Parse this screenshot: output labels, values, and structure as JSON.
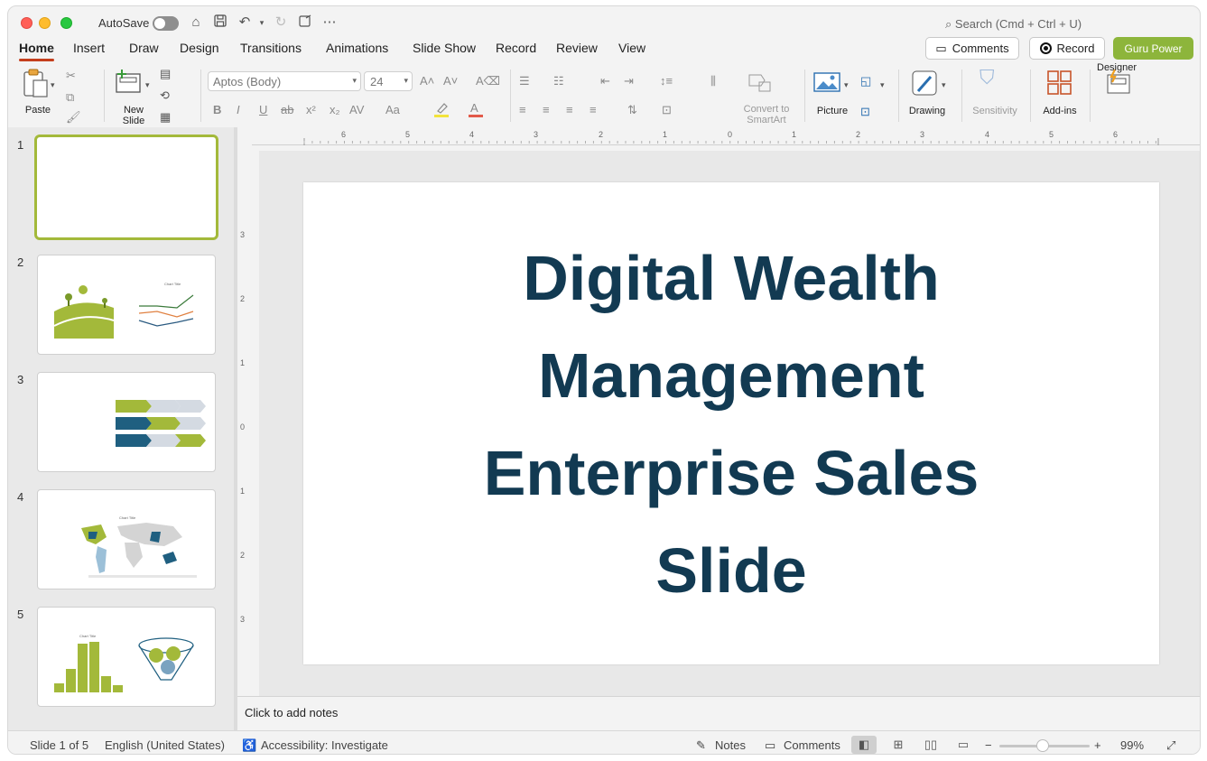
{
  "titlebar": {
    "autosave_label": "AutoSave",
    "search_placeholder": "Search (Cmd + Ctrl + U)"
  },
  "tabs": [
    "Home",
    "Insert",
    "Draw",
    "Design",
    "Transitions",
    "Animations",
    "Slide Show",
    "Record",
    "Review",
    "View"
  ],
  "active_tab": "Home",
  "header_buttons": {
    "comments": "Comments",
    "record": "Record",
    "guru": "Guru Power"
  },
  "ribbon": {
    "paste": "Paste",
    "new_slide_line1": "New",
    "new_slide_line2": "Slide",
    "font_name": "Aptos (Body)",
    "font_size": "24",
    "convert_line1": "Convert to",
    "convert_line2": "SmartArt",
    "picture": "Picture",
    "drawing": "Drawing",
    "sensitivity": "Sensitivity",
    "addins": "Add-ins",
    "designer": "Designer"
  },
  "slides": [
    {
      "num": "1",
      "selected": true
    },
    {
      "num": "2",
      "thumb_chart_title": "Chart Title"
    },
    {
      "num": "3"
    },
    {
      "num": "4",
      "thumb_chart_title": "Chart Title"
    },
    {
      "num": "5",
      "thumb_chart_title": "Chart Title"
    }
  ],
  "slide": {
    "title_line1": "Digital Wealth",
    "title_line2": "Management",
    "title_line3": "Enterprise Sales",
    "title_line4": "Slide"
  },
  "ruler": {
    "h_ticks": [
      "6",
      "5",
      "4",
      "3",
      "2",
      "1",
      "0",
      "1",
      "2",
      "3",
      "4",
      "5",
      "6"
    ],
    "v_ticks": [
      "3",
      "2",
      "1",
      "0",
      "1",
      "2",
      "3"
    ]
  },
  "notes": {
    "placeholder": "Click to add notes"
  },
  "statusbar": {
    "slide_pos": "Slide 1 of 5",
    "language": "English (United States)",
    "accessibility": "Accessibility: Investigate",
    "notes": "Notes",
    "comments": "Comments",
    "zoom": "99%"
  },
  "colors": {
    "title_text": "#123a52",
    "accent_green": "#a3b93a",
    "accent_blue": "#1f5f80",
    "tab_underline": "#c43e1c"
  }
}
